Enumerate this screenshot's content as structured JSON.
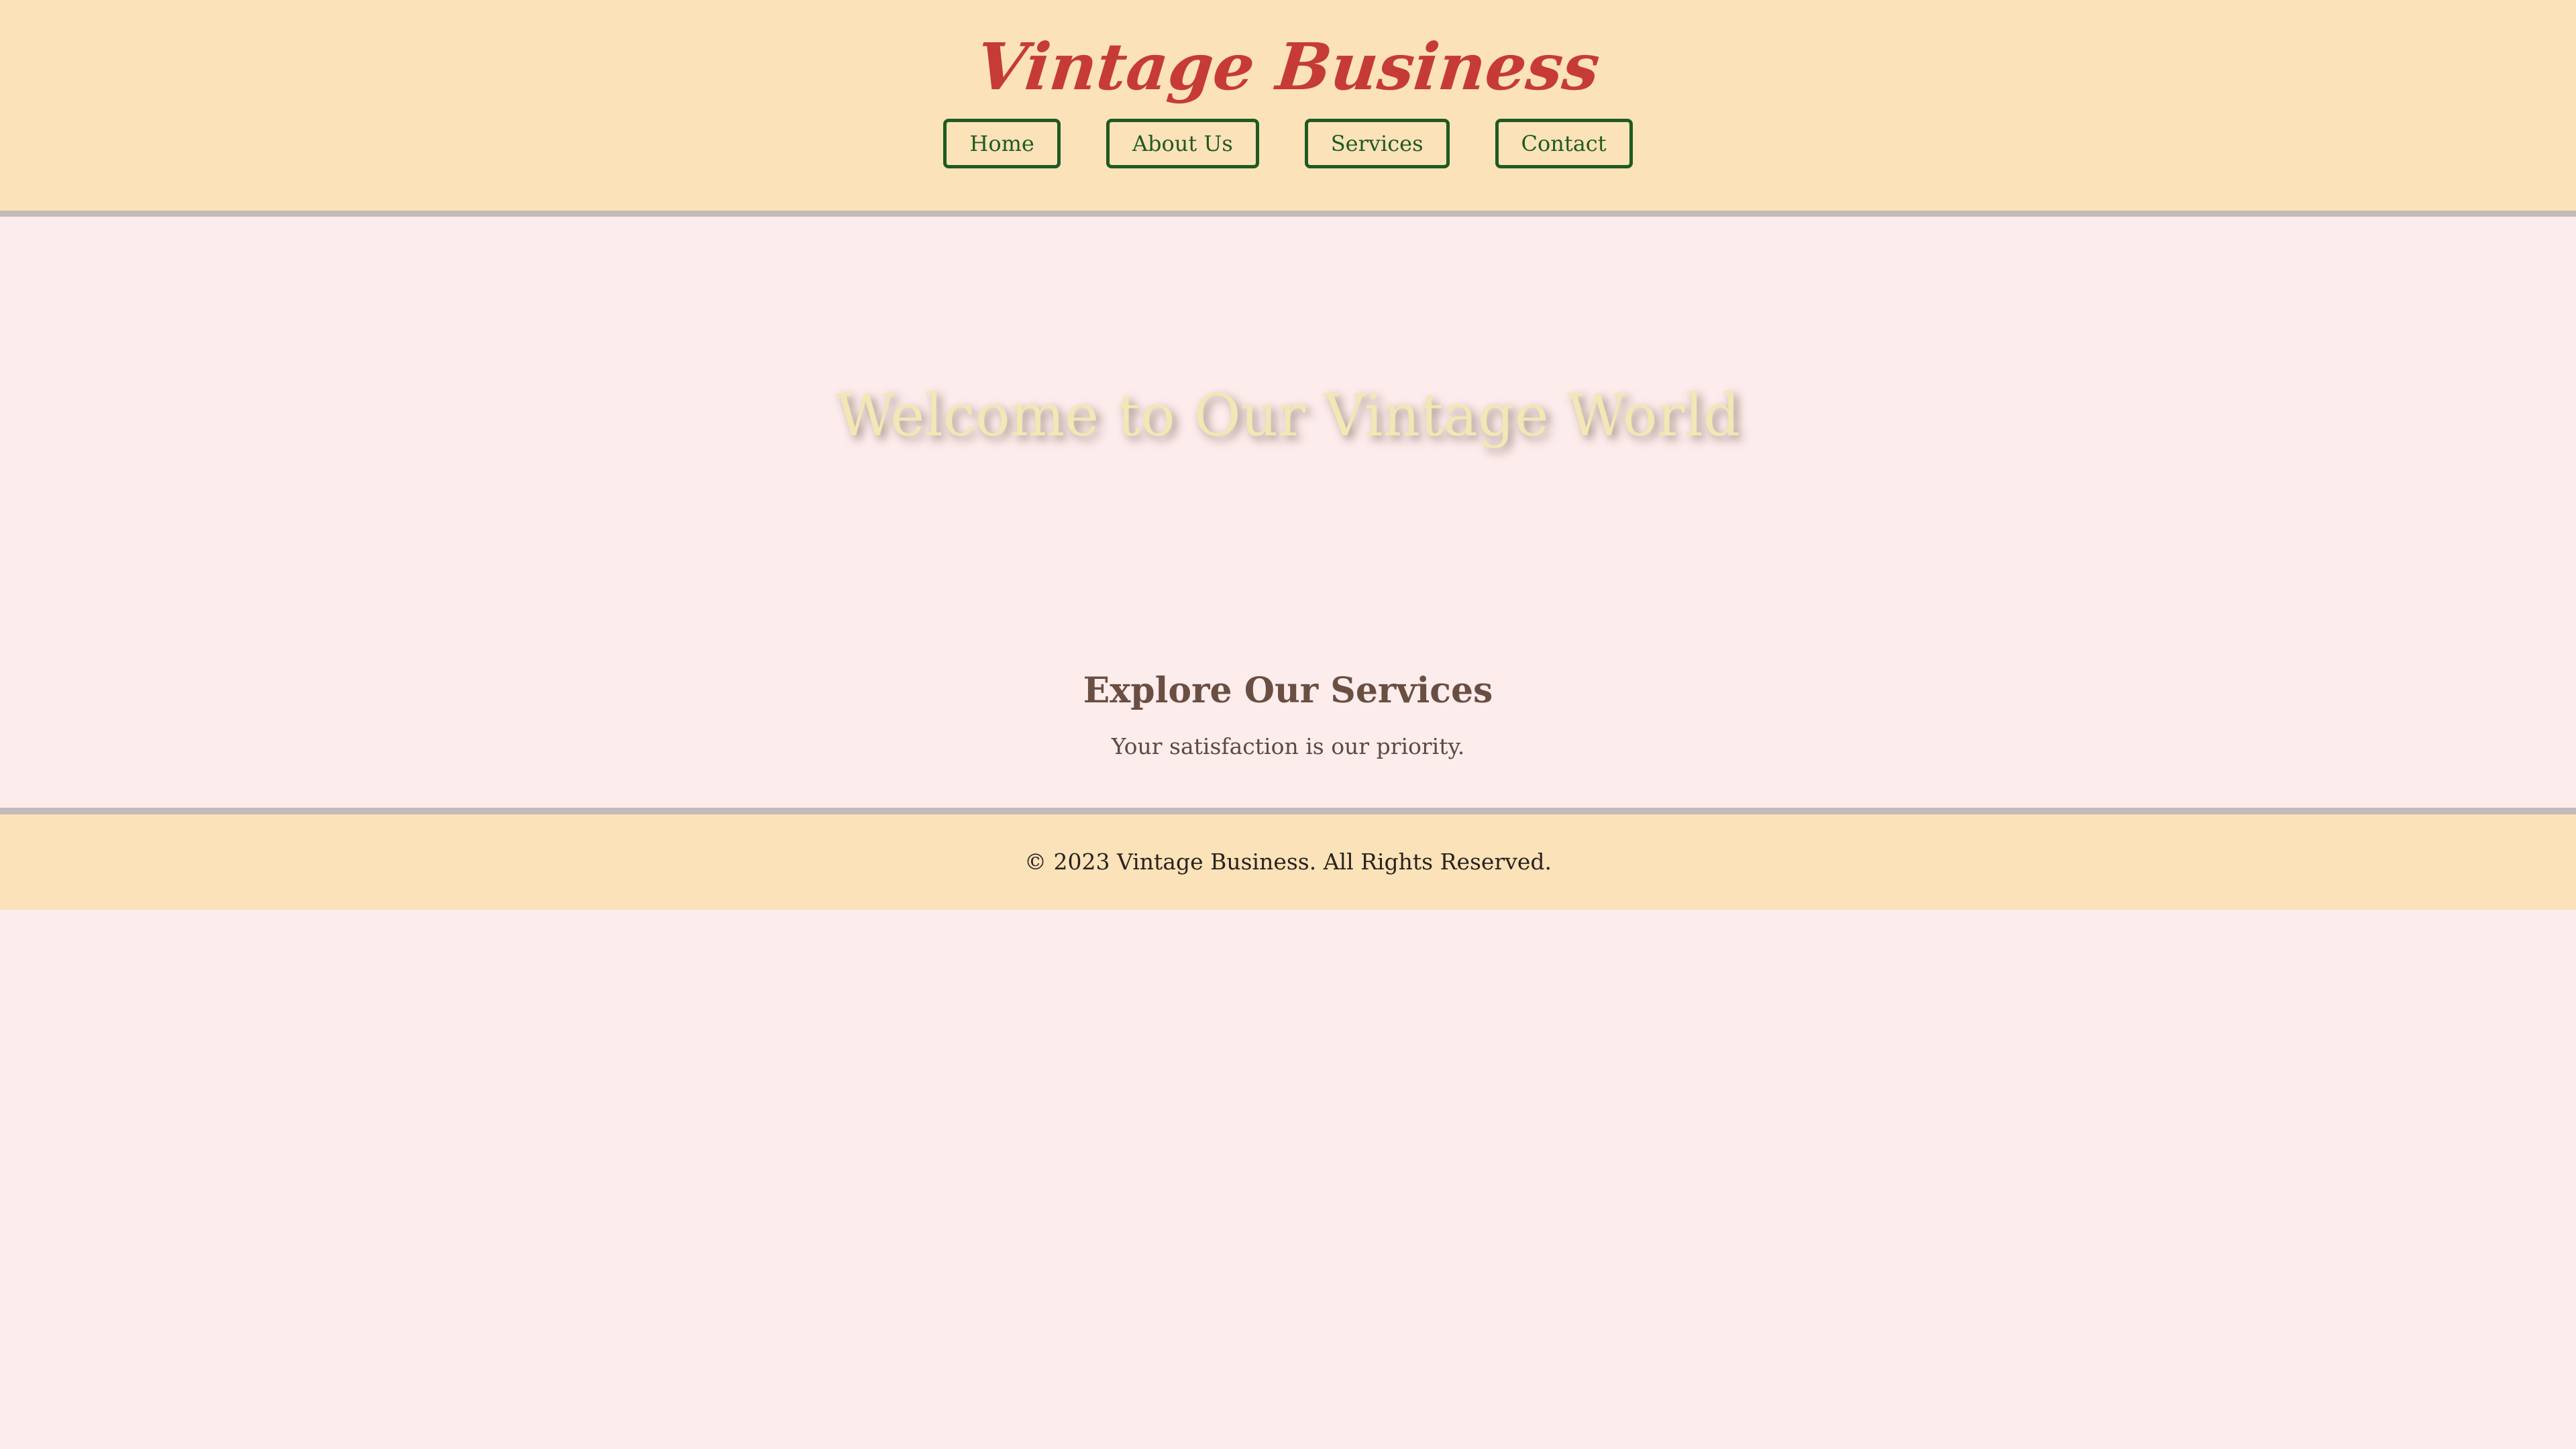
{
  "header": {
    "brand": "Vintage Business",
    "nav": [
      {
        "label": "Home"
      },
      {
        "label": "About Us"
      },
      {
        "label": "Services"
      },
      {
        "label": "Contact"
      }
    ]
  },
  "hero": {
    "title": "Welcome to Our Vintage World"
  },
  "services": {
    "title": "Explore Our Services",
    "subtitle": "Your satisfaction is our priority."
  },
  "footer": {
    "copyright": "© 2023 Vintage Business. All Rights Reserved."
  },
  "colors": {
    "header_bg": "#fbe2b8",
    "page_bg": "#fcecec",
    "brand": "#c63b35",
    "nav_accent": "#1f5a22",
    "hero_text": "#f2e7b5",
    "section_title": "#6a4e42",
    "divider": "#c3bbb7"
  }
}
